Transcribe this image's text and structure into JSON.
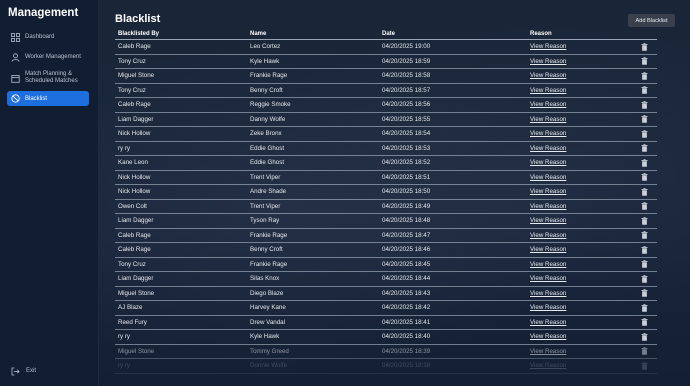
{
  "sidebar": {
    "brand": "Management",
    "items": [
      {
        "label": "Dashboard",
        "icon": "dashboard-grid-icon"
      },
      {
        "label": "Worker Management",
        "icon": "user-icon"
      },
      {
        "label_line1": "Match Planning &",
        "label_line2": "Scheduled Matches",
        "icon": "calendar-icon"
      },
      {
        "label": "Blacklist",
        "icon": "blocked-icon",
        "active": true
      }
    ],
    "exit_label": "Exit"
  },
  "main": {
    "title": "Blacklist",
    "add_button": "Add Blacklist",
    "columns": [
      "Blacklisted By",
      "Name",
      "Date",
      "Reason"
    ],
    "rows": [
      {
        "by": "Caleb Rage",
        "name": "Leo Cortez",
        "date": "04/20/2025 19:00",
        "reason": "View Reason"
      },
      {
        "by": "Tony Cruz",
        "name": "Kyle Hawk",
        "date": "04/20/2025 18:59",
        "reason": "View Reason"
      },
      {
        "by": "Miguel Stone",
        "name": "Frankie Rage",
        "date": "04/20/2025 18:58",
        "reason": "View Reason"
      },
      {
        "by": "Tony Cruz",
        "name": "Benny Croft",
        "date": "04/20/2025 18:57",
        "reason": "View Reason"
      },
      {
        "by": "Caleb Rage",
        "name": "Reggie Smoke",
        "date": "04/20/2025 18:56",
        "reason": "View Reason"
      },
      {
        "by": "Liam Dagger",
        "name": "Danny Wolfe",
        "date": "04/20/2025 18:55",
        "reason": "View Reason"
      },
      {
        "by": "Nick Hollow",
        "name": "Zeke Bronx",
        "date": "04/20/2025 18:54",
        "reason": "View Reason"
      },
      {
        "by": "ry ry",
        "name": "Eddie Ghost",
        "date": "04/20/2025 18:53",
        "reason": "View Reason"
      },
      {
        "by": "Kane Leon",
        "name": "Eddie Ghost",
        "date": "04/20/2025 18:52",
        "reason": "View Reason"
      },
      {
        "by": "Nick Hollow",
        "name": "Trent Viper",
        "date": "04/20/2025 18:51",
        "reason": "View Reason"
      },
      {
        "by": "Nick Hollow",
        "name": "Andre Shade",
        "date": "04/20/2025 18:50",
        "reason": "View Reason"
      },
      {
        "by": "Owen Colt",
        "name": "Trent Viper",
        "date": "04/20/2025 18:49",
        "reason": "View Reason"
      },
      {
        "by": "Liam Dagger",
        "name": "Tyson Ray",
        "date": "04/20/2025 18:48",
        "reason": "View Reason"
      },
      {
        "by": "Caleb Rage",
        "name": "Frankie Rage",
        "date": "04/20/2025 18:47",
        "reason": "View Reason"
      },
      {
        "by": "Caleb Rage",
        "name": "Benny Croft",
        "date": "04/20/2025 18:46",
        "reason": "View Reason"
      },
      {
        "by": "Tony Cruz",
        "name": "Frankie Rage",
        "date": "04/20/2025 18:45",
        "reason": "View Reason"
      },
      {
        "by": "Liam Dagger",
        "name": "Silas Knox",
        "date": "04/20/2025 18:44",
        "reason": "View Reason"
      },
      {
        "by": "Miguel Stone",
        "name": "Diego Blaze",
        "date": "04/20/2025 18:43",
        "reason": "View Reason"
      },
      {
        "by": "AJ Blaze",
        "name": "Harvey Kane",
        "date": "04/20/2025 18:42",
        "reason": "View Reason"
      },
      {
        "by": "Reed Fury",
        "name": "Drew Vandal",
        "date": "04/20/2025 18:41",
        "reason": "View Reason"
      },
      {
        "by": "ry ry",
        "name": "Kyle Hawk",
        "date": "04/20/2025 18:40",
        "reason": "View Reason"
      },
      {
        "by": "Miguel Stone",
        "name": "Tommy Greed",
        "date": "04/20/2025 18:39",
        "reason": "View Reason"
      },
      {
        "by": "ry ry",
        "name": "Donnie Wolfe",
        "date": "04/20/2025 18:38",
        "reason": "View Reason"
      }
    ]
  }
}
